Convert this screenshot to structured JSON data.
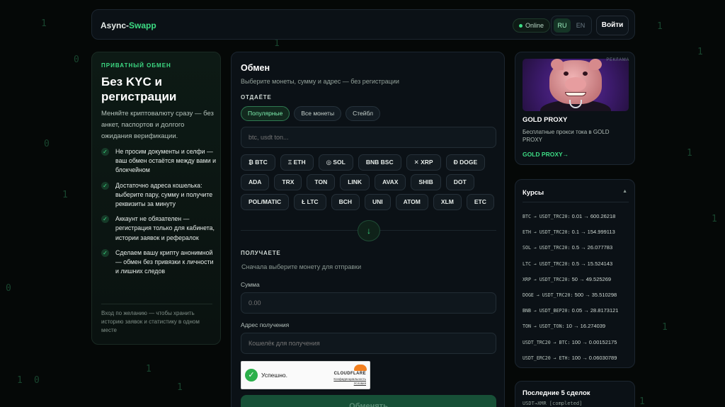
{
  "header": {
    "brand_part1": "Async-",
    "brand_part2": "Swapp",
    "online_label": "Online",
    "lang_ru": "RU",
    "lang_en": "EN",
    "login_label": "Войти"
  },
  "left_panel": {
    "kicker": "ПРИВАТНЫЙ ОБМЕН",
    "title": "Без KYC и регистрации",
    "lead": "Меняйте криптовалюту сразу — без анкет, паспортов и долгого ожидания верификации.",
    "features": [
      "Не просим документы и селфи — ваш обмен остаётся между вами и блокчейном",
      "Достаточно адреса кошелька: выберите пару, сумму и получите реквизиты за минуту",
      "Аккаунт не обязателен — регистрация только для кабинета, истории заявок и рефералок",
      "Сделаем вашу крипту анонимной — обмен без привязки к личности и лишних следов"
    ],
    "note": "Вход по желанию — чтобы хранить историю заявок и статистику в одном месте"
  },
  "exchange": {
    "title": "Обмен",
    "subtitle": "Выберите монеты, сумму и адрес — без регистрации",
    "give_label": "ОТДАЁТЕ",
    "filters": [
      "Популярные",
      "Все монеты",
      "Стейбл"
    ],
    "search_placeholder": "btc, usdt ton...",
    "coins": [
      "₿ BTC",
      "Ξ ETH",
      "◎ SOL",
      "BNB BSC",
      "✕ XRP",
      "Ð DOGE",
      "ADA",
      "TRX",
      "TON",
      "LINK",
      "AVAX",
      "SHIB",
      "DOT",
      "POL/MATIC",
      "Ł LTC",
      "BCH",
      "UNI",
      "ATOM",
      "XLM",
      "ETC"
    ],
    "receive_label": "ПОЛУЧАЕТЕ",
    "receive_hint": "Сначала выберите монету для отправки",
    "amount_label": "Сумма",
    "amount_placeholder": "0.00",
    "address_label": "Адрес получения",
    "address_placeholder": "Кошелёк для получения",
    "captcha_status": "Успешно.",
    "captcha_brand": "CLOUDFLARE",
    "captcha_privacy": "Конфиденциальность",
    "captcha_terms": "Условия",
    "submit_label": "Обменять"
  },
  "ad": {
    "tag": "РЕКЛАМА",
    "title": "GOLD PROXY",
    "description": "Бесплатные прокси тока в GOLD PROXY",
    "link": "GOLD PROXY→"
  },
  "rates": {
    "title": "Курсы",
    "items": [
      {
        "pair": "BTC → USDT_TRC20:",
        "value": "0.01 → 600.26218"
      },
      {
        "pair": "ETH → USDT_TRC20:",
        "value": "0.1 → 154.999113"
      },
      {
        "pair": "SOL → USDT_TRC20:",
        "value": "0.5 → 26.077783"
      },
      {
        "pair": "LTC → USDT_TRC20:",
        "value": "0.5 → 15.524143"
      },
      {
        "pair": "XRP → USDT_TRC20:",
        "value": "50 → 49.525269"
      },
      {
        "pair": "DOGE → USDT_TRC20:",
        "value": "500 → 35.510298"
      },
      {
        "pair": "BNB → USDT_BEP20:",
        "value": "0.05 → 28.8173121"
      },
      {
        "pair": "TON → USDT_TON:",
        "value": "10 → 16.274039"
      },
      {
        "pair": "USDT_TRC20 → BTC:",
        "value": "100 → 0.00152175"
      },
      {
        "pair": "USDT_ERC20 → ETH:",
        "value": "100 → 0.06030789"
      }
    ]
  },
  "trades": {
    "title": "Последние 5 сделок",
    "first_row": "USDT→XMR [completed]"
  },
  "colors": {
    "accent": "#3ddc84",
    "background": "#050807",
    "panel": "#0b1116"
  }
}
